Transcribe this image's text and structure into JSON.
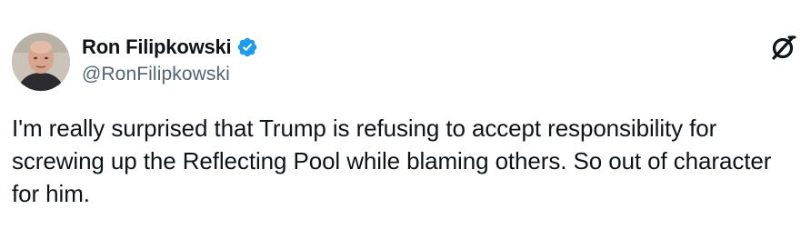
{
  "author": {
    "display_name": "Ron Filipkowski",
    "handle": "@RonFilipkowski",
    "verified": true
  },
  "icons": {
    "avatar": "profile-photo",
    "verified": "verified-badge-icon",
    "platform": "x-logo-icon"
  },
  "colors": {
    "text": "#0f1419",
    "secondary": "#536471",
    "verified": "#1d9bf0"
  },
  "tweet": {
    "text": "I'm really surprised that Trump is refusing to accept responsibility for screwing up the Reflecting Pool while blaming others. So out of character for him."
  }
}
